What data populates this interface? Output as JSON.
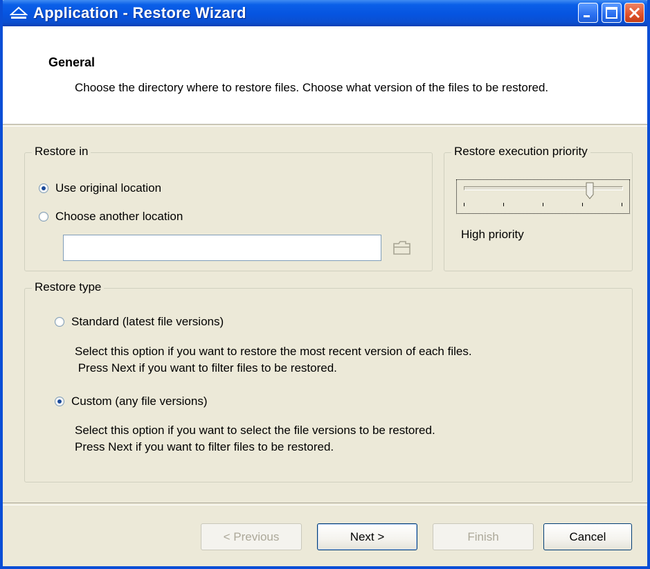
{
  "window": {
    "title": "Application - Restore Wizard",
    "controls": {
      "minimize": "minimize",
      "maximize": "maximize",
      "close": "close"
    }
  },
  "header": {
    "title": "General",
    "description": "Choose the directory where to restore files. Choose what version of the files to be restored."
  },
  "restore_in": {
    "label": "Restore in",
    "options": [
      {
        "label": "Use original location",
        "checked": true
      },
      {
        "label": "Choose another location",
        "checked": false
      }
    ],
    "path_value": ""
  },
  "priority": {
    "label": "Restore execution priority",
    "level_text": "High priority",
    "slider_level_fraction": 0.8,
    "tick_count": 5
  },
  "restore_type": {
    "label": "Restore type",
    "options": [
      {
        "label": "Standard (latest file versions)",
        "checked": false,
        "description_line1": "Select this option if you want to restore the most recent version of each files.",
        "description_line2": " Press Next if you want to filter files to be restored."
      },
      {
        "label": "Custom (any file versions)",
        "checked": true,
        "description_line1": "Select this option if you want to select the file versions to be restored.",
        "description_line2": "Press Next if you want to filter files to be restored."
      }
    ]
  },
  "buttons": {
    "previous": "< Previous",
    "next": "Next >",
    "finish": "Finish",
    "cancel": "Cancel"
  },
  "colors": {
    "titlebar": "#0654e0",
    "window_bg": "#ece9d8",
    "close_button": "#e0512a"
  }
}
